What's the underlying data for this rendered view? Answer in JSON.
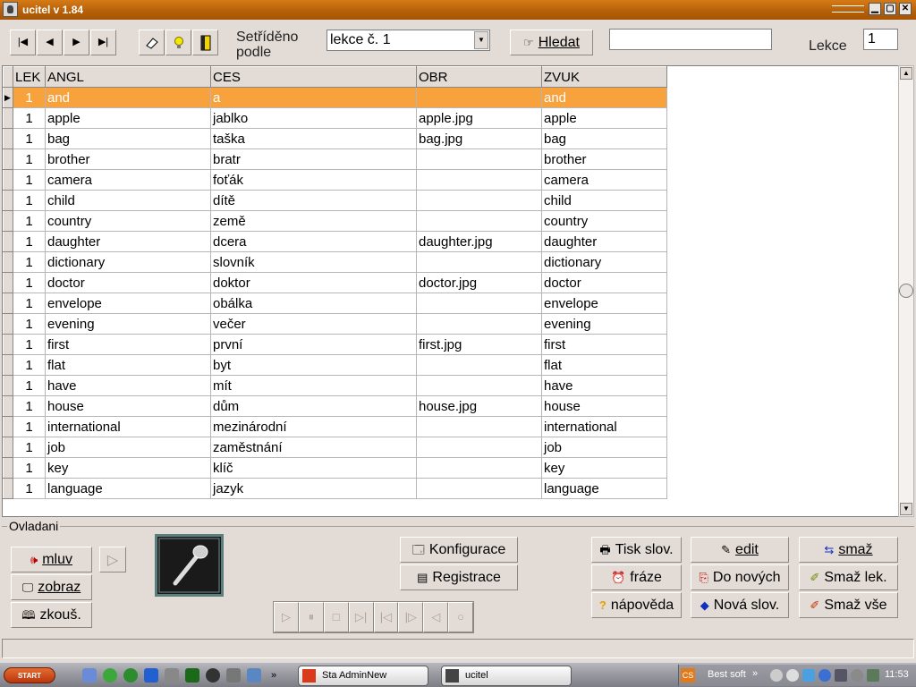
{
  "window": {
    "title": "ucitel v 1.84",
    "minimize": "▁",
    "maximize": "▢",
    "close": "✕"
  },
  "toolbar": {
    "nav": [
      "|◀",
      "◀",
      "▶",
      "▶|"
    ],
    "sort_label": "Setříděno podle",
    "sort_value": "lekce č. 1",
    "search_button": "Hledat",
    "search_value": "",
    "lesson_label": "Lekce",
    "lesson_value": "1"
  },
  "table": {
    "columns": [
      "LEK",
      "ANGL",
      "CES",
      "OBR",
      "ZVUK"
    ],
    "selected_row": 0,
    "rows": [
      [
        "1",
        "and",
        "a",
        "",
        "and"
      ],
      [
        "1",
        "apple",
        "jablko",
        "apple.jpg",
        "apple"
      ],
      [
        "1",
        "bag",
        "taška",
        "bag.jpg",
        "bag"
      ],
      [
        "1",
        "brother",
        "bratr",
        "",
        "brother"
      ],
      [
        "1",
        "camera",
        "foťák",
        "",
        "camera"
      ],
      [
        "1",
        "child",
        "dítě",
        "",
        "child"
      ],
      [
        "1",
        "country",
        "země",
        "",
        "country"
      ],
      [
        "1",
        "daughter",
        "dcera",
        "daughter.jpg",
        "daughter"
      ],
      [
        "1",
        "dictionary",
        "slovník",
        "",
        "dictionary"
      ],
      [
        "1",
        "doctor",
        "doktor",
        "doctor.jpg",
        "doctor"
      ],
      [
        "1",
        "envelope",
        "obálka",
        "",
        "envelope"
      ],
      [
        "1",
        "evening",
        "večer",
        "",
        "evening"
      ],
      [
        "1",
        "first",
        "první",
        "first.jpg",
        "first"
      ],
      [
        "1",
        "flat",
        "byt",
        "",
        "flat"
      ],
      [
        "1",
        "have",
        "mít",
        "",
        "have"
      ],
      [
        "1",
        "house",
        "dům",
        "house.jpg",
        "house"
      ],
      [
        "1",
        "international",
        "mezinárodní",
        "",
        "international"
      ],
      [
        "1",
        "job",
        "zaměstnání",
        "",
        "job"
      ],
      [
        "1",
        "key",
        "klíč",
        "",
        "key"
      ],
      [
        "1",
        "language",
        "jazyk",
        "",
        "language"
      ]
    ]
  },
  "controls": {
    "group_label": "Ovladani",
    "mluv": "mluv",
    "zobraz": "zobraz",
    "zkous": "zkouš.",
    "play_small": "▷",
    "konfigurace": "Konfigurace",
    "registrace": "Registrace",
    "tisk": "Tisk slov.",
    "fraze": "fráze",
    "napoveda": "nápověda",
    "edit": "edit",
    "do_novych": "Do nových",
    "nova_slov": "Nová slov.",
    "smaz": "smaž",
    "smaz_lek": "Smaž lek.",
    "smaz_vse": "Smaž vše",
    "media": [
      "▷",
      "⏸",
      "□",
      "▷|",
      "|◁",
      "|▷",
      "◁",
      "○"
    ]
  },
  "taskbar": {
    "start": "START",
    "tasks": [
      "Sta AdminNew",
      "ucitel"
    ],
    "tray_text": "Best soft",
    "tray_cs": "CS",
    "tray_chevron": "»",
    "clock": "11:53"
  },
  "colors": {
    "selection": "#f7a23c",
    "titlebar": "#c06a0e",
    "face": "#e3dcd6"
  }
}
